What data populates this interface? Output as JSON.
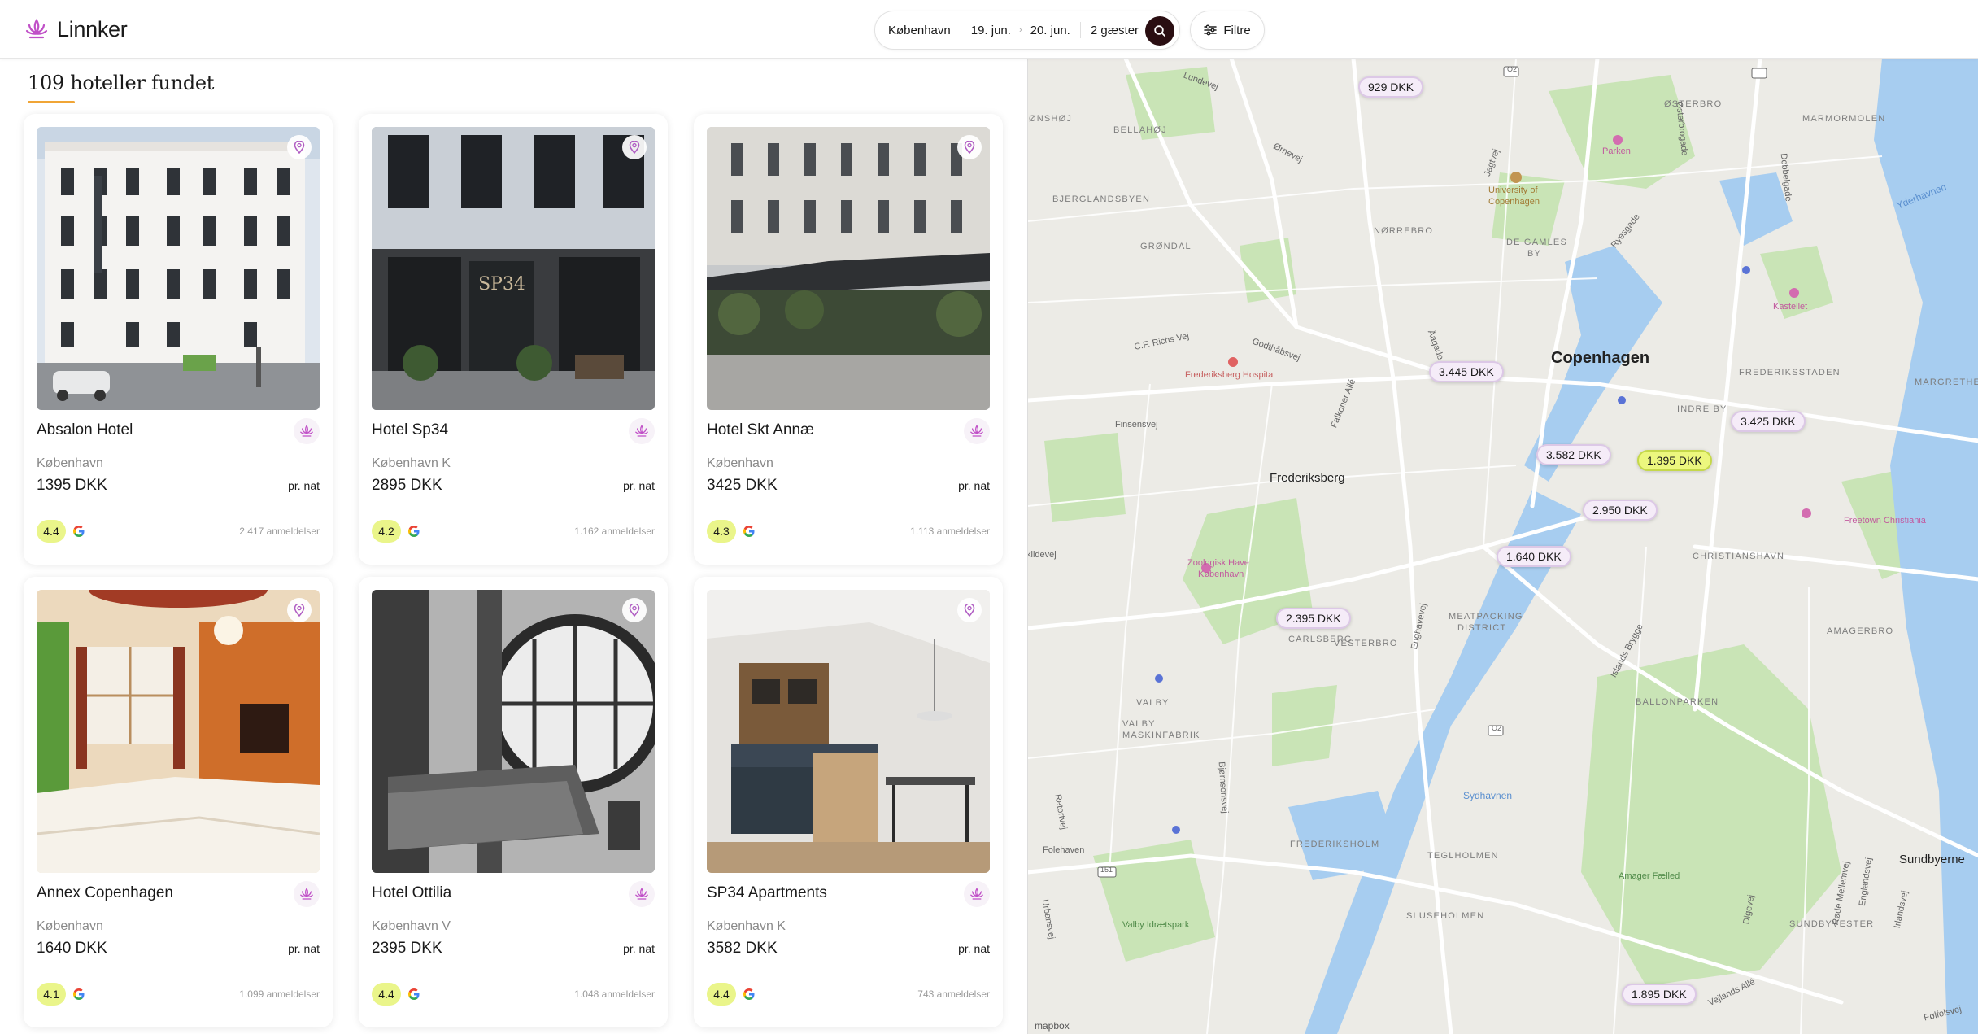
{
  "app": {
    "name": "Linnker"
  },
  "search": {
    "location": "København",
    "checkin": "19. jun.",
    "checkout": "20. jun.",
    "guests": "2 gæster"
  },
  "filters": {
    "label": "Filtre"
  },
  "results": {
    "title": "109 hoteller fundet"
  },
  "hotels": [
    {
      "name": "Absalon Hotel",
      "city": "København",
      "price": "1395 DKK",
      "per": "pr. nat",
      "rating": "4.4",
      "reviews": "2.417 anmeldelser"
    },
    {
      "name": "Hotel Sp34",
      "city": "København K",
      "price": "2895 DKK",
      "per": "pr. nat",
      "rating": "4.2",
      "reviews": "1.162 anmeldelser"
    },
    {
      "name": "Hotel Skt Annæ",
      "city": "København",
      "price": "3425 DKK",
      "per": "pr. nat",
      "rating": "4.3",
      "reviews": "1.113 anmeldelser"
    },
    {
      "name": "Annex Copenhagen",
      "city": "København",
      "price": "1640 DKK",
      "per": "pr. nat",
      "rating": "4.1",
      "reviews": "1.099 anmeldelser"
    },
    {
      "name": "Hotel Ottilia",
      "city": "København V",
      "price": "2395 DKK",
      "per": "pr. nat",
      "rating": "4.4",
      "reviews": "1.048 anmeldelser"
    },
    {
      "name": "SP34 Apartments",
      "city": "København K",
      "price": "3582 DKK",
      "per": "pr. nat",
      "rating": "4.4",
      "reviews": "743 anmeldelser"
    }
  ],
  "map": {
    "price_pins": [
      "929 DKK",
      "3.445 DKK",
      "3.425 DKK",
      "3.582 DKK",
      "1.395 DKK",
      "2.950 DKK",
      "1.640 DKK",
      "2.395 DKK",
      "1.895 DKK"
    ],
    "labels": {
      "city": "Copenhagen",
      "frederiksberg": "Frederiksberg",
      "sundbyerne": "Sundbyerne",
      "osterbro": "ØSTERBRO",
      "marmormolen": "MARMORMOLEN",
      "onshoj": "ØNSHØJ",
      "bellahoj": "BELLAHØJ",
      "bjerglandsbyen": "BJERGLANDSBYEN",
      "norrebro": "NØRREBRO",
      "grondal": "GRØNDAL",
      "degamles": "DE GAMLES",
      "by": "BY",
      "frederiksstaden": "FREDERIKSSTADEN",
      "margrethehol": "MARGRETHEHOL",
      "indreby": "INDRE BY",
      "christianshavn": "CHRISTIANSHAVN",
      "meatpacking": "MEATPACKING",
      "district": "DISTRICT",
      "vesterbro": "VESTERBRO",
      "carlsberg": "CARLSBERG",
      "amagerbro": "AMAGERBRO",
      "valby": "VALBY",
      "valbymaskin": "VALBY",
      "maskinfabrik": "MASKINFABRIK",
      "ballonparken": "BALLONPARKEN",
      "frederiksholm": "FREDERIKSHOLM",
      "teglholmen": "TEGLHOLMEN",
      "sluseholmen": "SLUSEHOLMEN",
      "sundbyvester": "SUNDBYVESTER",
      "universityA": "University of",
      "universityB": "Copenhagen",
      "parken": "Parken",
      "kastellet": "Kastellet",
      "hospital": "Frederiksberg Hospital",
      "zooA": "Zoologisk Have",
      "zooB": "København",
      "freetown": "Freetown Christiania",
      "amagerfaelled": "Amager Fælled",
      "valbyidraet": "Valby Idrætspark",
      "sydhavnen": "Sydhavnen",
      "yderhavnen": "Yderhavnen",
      "folehaven": "Folehaven",
      "finsensvej": "Finsensvej",
      "crichs": "C.F. Richs Vej",
      "godthabsvej": "Godthåbsvej",
      "falkoner": "Falkoner Allé",
      "jagtvej": "Jagtvej",
      "ryesgade": "Ryesgade",
      "orevej": "Ørnevej",
      "lundevej": "Lundevej",
      "enghavevej": "Enghavevej",
      "bjornsonsvej": "Bjørnsonsvej",
      "retortvej": "Retortvej",
      "urbansvej": "Urbansvej",
      "islands": "Islands Brygge",
      "rode": "Røde Mellemvej",
      "englandsvej": "Englandsvej",
      "irlandsvej": "Irlandsvej",
      "veilands": "Vejlands Allé",
      "falfolsvej": "Følfolsvej",
      "kildevej": "kildevej",
      "osterbrogade": "Østerbrogade",
      "dobbelgade": "Dobbelgade",
      "oagade": "Åagade",
      "digevej": "Digevej",
      "road02a": "O2",
      "road02b": "O2",
      "road151": "151",
      "mapbox": "mapbox"
    }
  }
}
